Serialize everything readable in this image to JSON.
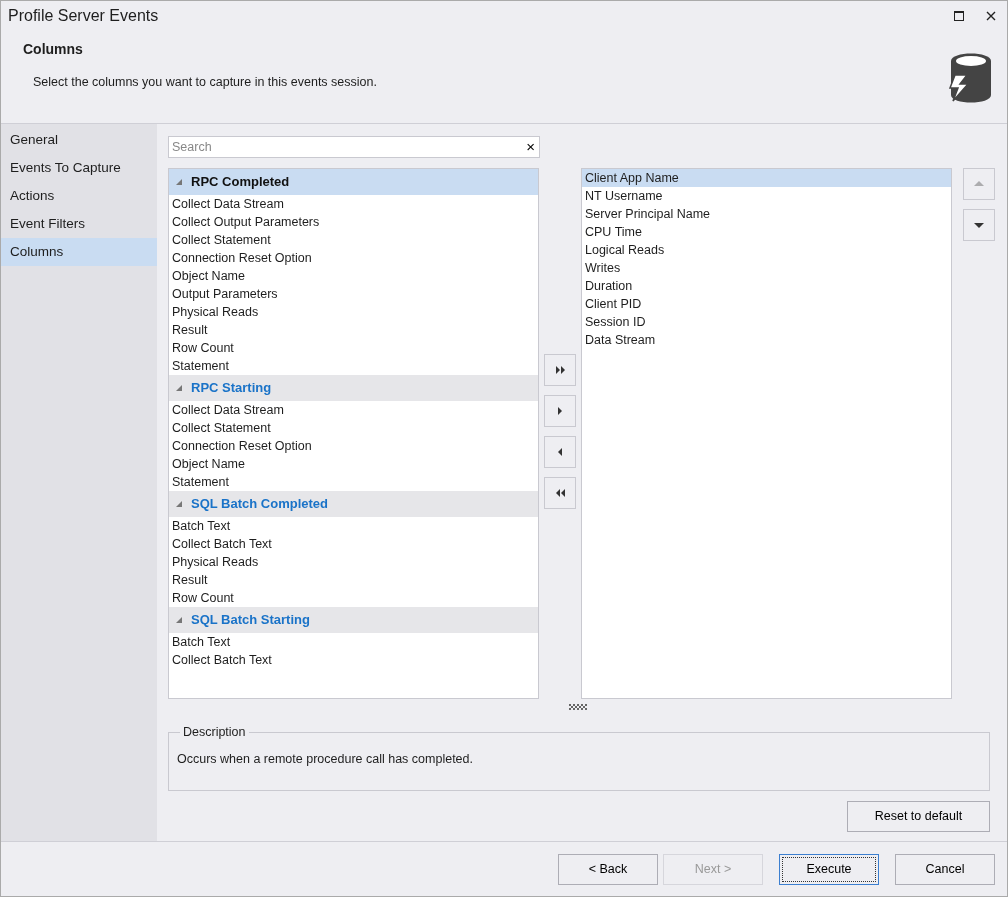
{
  "window": {
    "title": "Profile Server Events"
  },
  "header": {
    "title": "Columns",
    "subtitle": "Select the columns you want to capture in this events session."
  },
  "sidebar": {
    "items": [
      {
        "label": "General",
        "selected": false
      },
      {
        "label": "Events To Capture",
        "selected": false
      },
      {
        "label": "Actions",
        "selected": false
      },
      {
        "label": "Event Filters",
        "selected": false
      },
      {
        "label": "Columns",
        "selected": true
      }
    ]
  },
  "search": {
    "placeholder": "Search",
    "clear": "×"
  },
  "available": {
    "groups": [
      {
        "name": "RPC Completed",
        "selected": true,
        "expanded": true,
        "items": [
          "Collect Data Stream",
          "Collect Output Parameters",
          "Collect Statement",
          "Connection Reset Option",
          "Object Name",
          "Output Parameters",
          "Physical Reads",
          "Result",
          "Row Count",
          "Statement"
        ]
      },
      {
        "name": "RPC Starting",
        "selected": false,
        "expanded": true,
        "items": [
          "Collect Data Stream",
          "Collect Statement",
          "Connection Reset Option",
          "Object Name",
          "Statement"
        ]
      },
      {
        "name": "SQL Batch Completed",
        "selected": false,
        "expanded": true,
        "items": [
          "Batch Text",
          "Collect Batch Text",
          "Physical Reads",
          "Result",
          "Row Count"
        ]
      },
      {
        "name": "SQL Batch Starting",
        "selected": false,
        "expanded": true,
        "items": [
          "Batch Text",
          "Collect Batch Text"
        ]
      }
    ]
  },
  "transfer_buttons": [
    {
      "kind": "add-all"
    },
    {
      "kind": "add"
    },
    {
      "kind": "remove"
    },
    {
      "kind": "remove-all"
    }
  ],
  "selected_columns": [
    {
      "label": "Client App Name",
      "selected": true
    },
    {
      "label": "NT Username",
      "selected": false
    },
    {
      "label": "Server Principal Name",
      "selected": false
    },
    {
      "label": "CPU Time",
      "selected": false
    },
    {
      "label": "Logical Reads",
      "selected": false
    },
    {
      "label": "Writes",
      "selected": false
    },
    {
      "label": "Duration",
      "selected": false
    },
    {
      "label": "Client PID",
      "selected": false
    },
    {
      "label": "Session ID",
      "selected": false
    },
    {
      "label": "Data Stream",
      "selected": false
    }
  ],
  "order_buttons": [
    {
      "kind": "up",
      "disabled": true
    },
    {
      "kind": "down",
      "disabled": false
    }
  ],
  "description": {
    "legend": "Description",
    "text": "Occurs when a remote procedure call has completed."
  },
  "reset_button": {
    "label": "Reset to default"
  },
  "footer_buttons": [
    {
      "label": "< Back",
      "disabled": false,
      "focused": false
    },
    {
      "label": "Next >",
      "disabled": true,
      "focused": false
    },
    {
      "label": "Execute",
      "disabled": false,
      "focused": true
    },
    {
      "label": "Cancel",
      "disabled": false,
      "focused": false
    }
  ]
}
